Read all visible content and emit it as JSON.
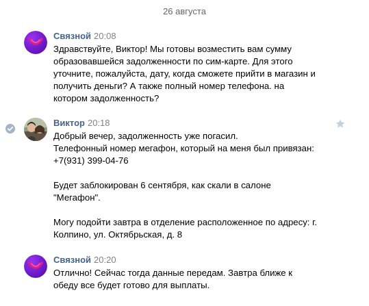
{
  "date_separator": "26 августа",
  "messages": [
    {
      "author": "Связной",
      "time": "20:08",
      "avatar": "svyaznoy-logo",
      "text": "Здравствуйте, Виктор! Мы готовы возместить вам сумму\nобразовавшейся задолженности по сим-карте. Для этого\nуточните, пожалуйста, дату, когда сможете прийти в магазин и\nполучить деньги? А также полный номер телефона. на\nкотором задолженность?"
    },
    {
      "author": "Виктор",
      "time": "20:18",
      "avatar": "user-photo",
      "text": "Добрый вечер, задолженность уже погасил.\nТелефонный номер мегафон, который на меня был привязан:\n+7(931) 399-04-76\n\nБудет заблокирован 6 сентября, как скали в салоне\n\"Мегафон\".\n\nМогу подойти завтра в отделение расположенное по адресу: г.\nКолпино, ул. Октябрьская, д. 8"
    },
    {
      "author": "Связной",
      "time": "20:20",
      "avatar": "svyaznoy-logo",
      "text": "Отлично! Сейчас тогда данные передам. Завтра ближе к\nобеду все будет готово для выплаты."
    }
  ],
  "colors": {
    "author": "#42648b",
    "time": "#828282",
    "brand_purple": "#7b1fd6",
    "brand_magenta": "#d6196e"
  }
}
